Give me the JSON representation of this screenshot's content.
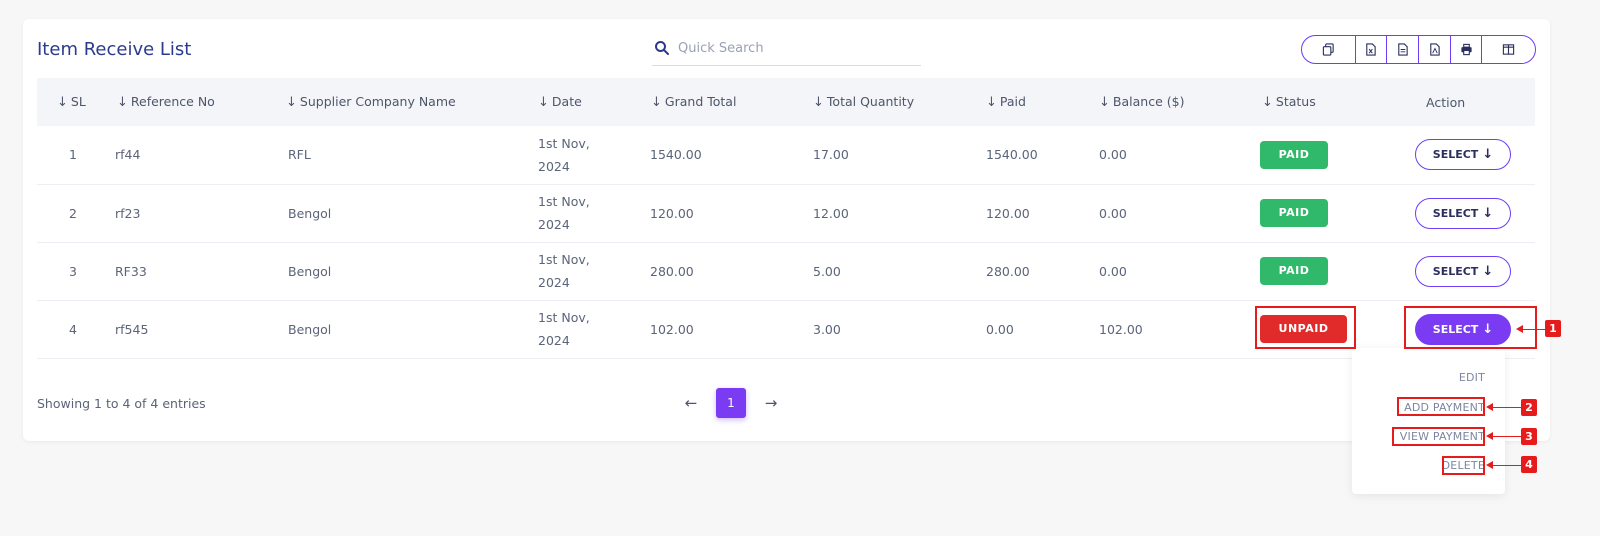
{
  "page": {
    "title": "Item Receive List"
  },
  "search": {
    "placeholder": "Quick Search"
  },
  "toolbar": {
    "buttons": [
      "copy-icon",
      "excel-icon",
      "csv-icon",
      "pdf-icon",
      "print-icon",
      "columns-icon"
    ]
  },
  "table": {
    "headers": [
      "SL",
      "Reference No",
      "Supplier Company Name",
      "Date",
      "Grand Total",
      "Total Quantity",
      "Paid",
      "Balance ($)",
      "Status",
      "Action"
    ],
    "rows": [
      {
        "sl": "1",
        "ref": "rf44",
        "supplier": "RFL",
        "date_line1": "1st Nov,",
        "date_line2": "2024",
        "grand_total": "1540.00",
        "total_qty": "17.00",
        "paid": "1540.00",
        "balance": "0.00",
        "status": "PAID",
        "action": "SELECT"
      },
      {
        "sl": "2",
        "ref": "rf23",
        "supplier": "Bengol",
        "date_line1": "1st Nov,",
        "date_line2": "2024",
        "grand_total": "120.00",
        "total_qty": "12.00",
        "paid": "120.00",
        "balance": "0.00",
        "status": "PAID",
        "action": "SELECT"
      },
      {
        "sl": "3",
        "ref": "RF33",
        "supplier": "Bengol",
        "date_line1": "1st Nov,",
        "date_line2": "2024",
        "grand_total": "280.00",
        "total_qty": "5.00",
        "paid": "280.00",
        "balance": "0.00",
        "status": "PAID",
        "action": "SELECT"
      },
      {
        "sl": "4",
        "ref": "rf545",
        "supplier": "Bengol",
        "date_line1": "1st Nov,",
        "date_line2": "2024",
        "grand_total": "102.00",
        "total_qty": "3.00",
        "paid": "0.00",
        "balance": "102.00",
        "status": "UNPAID",
        "action": "SELECT"
      }
    ]
  },
  "footer": {
    "info": "Showing 1 to 4 of 4 entries",
    "current_page": "1",
    "prev": "←",
    "next": "→"
  },
  "dropdown": {
    "items": [
      "EDIT",
      "ADD PAYMENT",
      "VIEW PAYMENT",
      "DELETE"
    ]
  },
  "callouts": [
    "1",
    "2",
    "3",
    "4"
  ],
  "colors": {
    "accent": "#7a3bf2",
    "paid": "#31b96b",
    "unpaid": "#e12b2b",
    "title": "#2b3a8c",
    "highlight": "#e61c1c"
  }
}
